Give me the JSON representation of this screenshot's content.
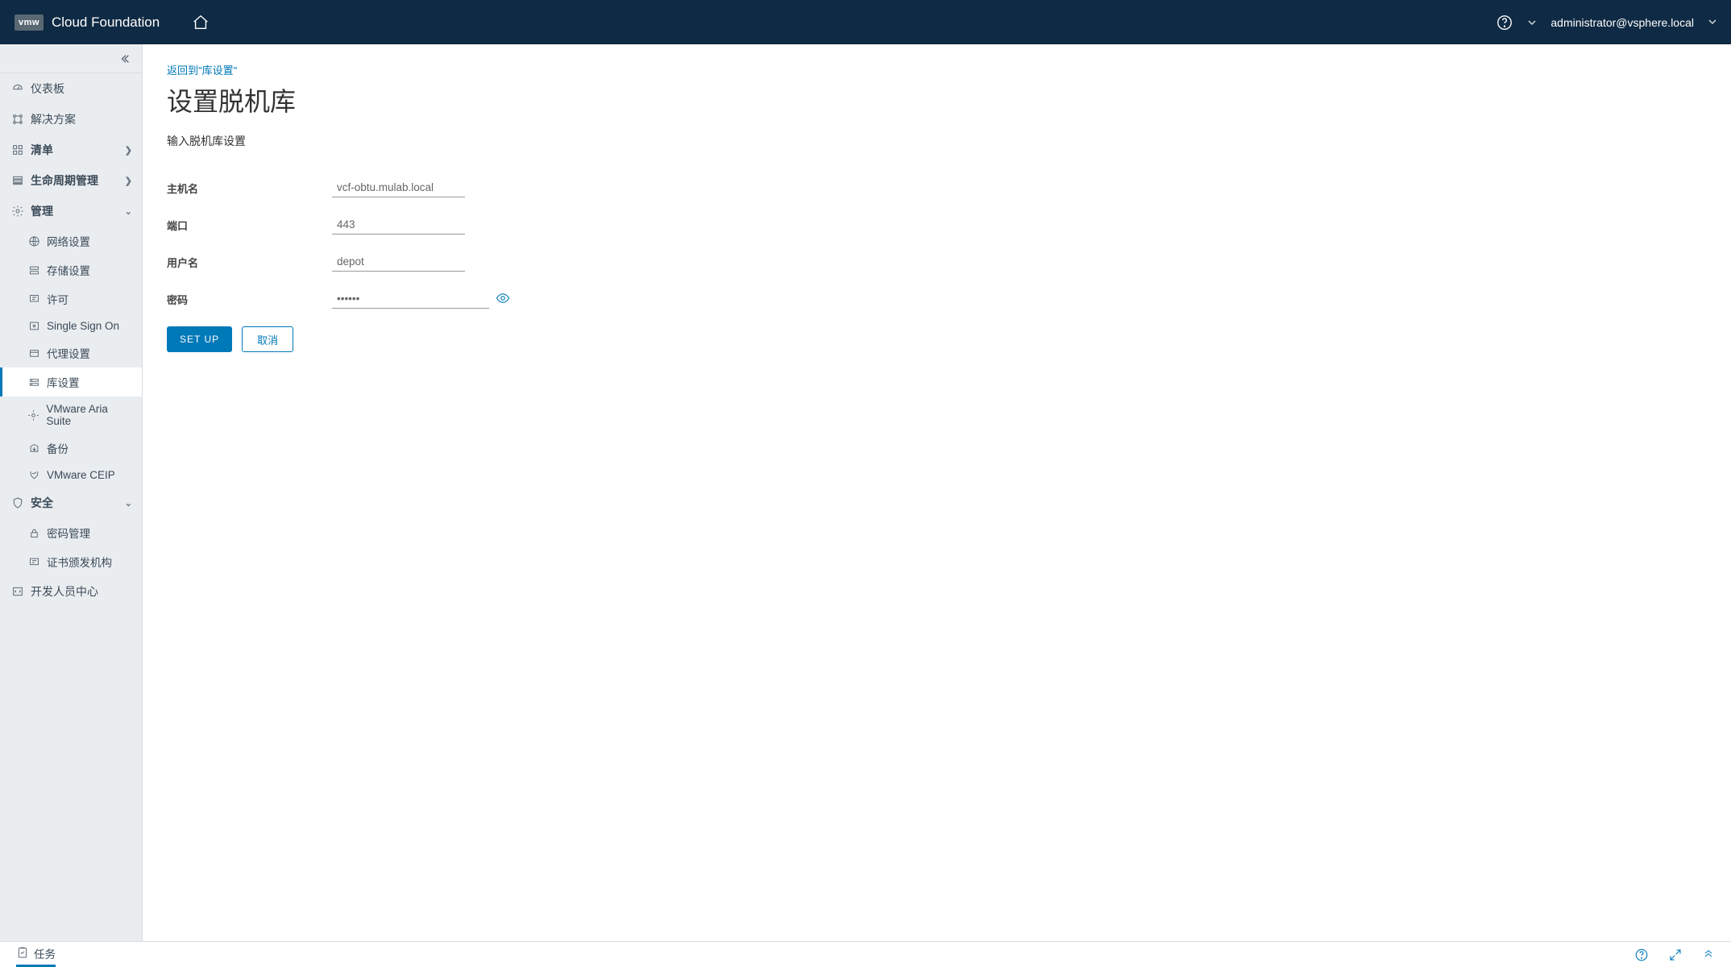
{
  "header": {
    "logo_text": "vmw",
    "product_name": "Cloud Foundation",
    "user_label": "administrator@vsphere.local"
  },
  "sidebar": {
    "items": [
      {
        "label": "仪表板"
      },
      {
        "label": "解决方案"
      },
      {
        "label": "清单"
      },
      {
        "label": "生命周期管理"
      },
      {
        "label": "管理"
      }
    ],
    "admin_children": [
      {
        "label": "网络设置"
      },
      {
        "label": "存储设置"
      },
      {
        "label": "许可"
      },
      {
        "label": "Single Sign On"
      },
      {
        "label": "代理设置"
      },
      {
        "label": "库设置"
      },
      {
        "label": "VMware Aria Suite"
      },
      {
        "label": "备份"
      },
      {
        "label": "VMware CEIP"
      }
    ],
    "security_label": "安全",
    "security_children": [
      {
        "label": "密码管理"
      },
      {
        "label": "证书颁发机构"
      }
    ],
    "dev_center_label": "开发人员中心"
  },
  "main": {
    "back_link": "返回到\"库设置\"",
    "title": "设置脱机库",
    "subtitle": "输入脱机库设置",
    "form": {
      "host_label": "主机名",
      "host_value": "vcf-obtu.mulab.local",
      "port_label": "端口",
      "port_value": "443",
      "user_label": "用户名",
      "user_value": "depot",
      "pass_label": "密码",
      "pass_value": "••••••"
    },
    "actions": {
      "setup": "SET UP",
      "cancel": "取消"
    }
  },
  "footer": {
    "tasks_label": "任务"
  }
}
